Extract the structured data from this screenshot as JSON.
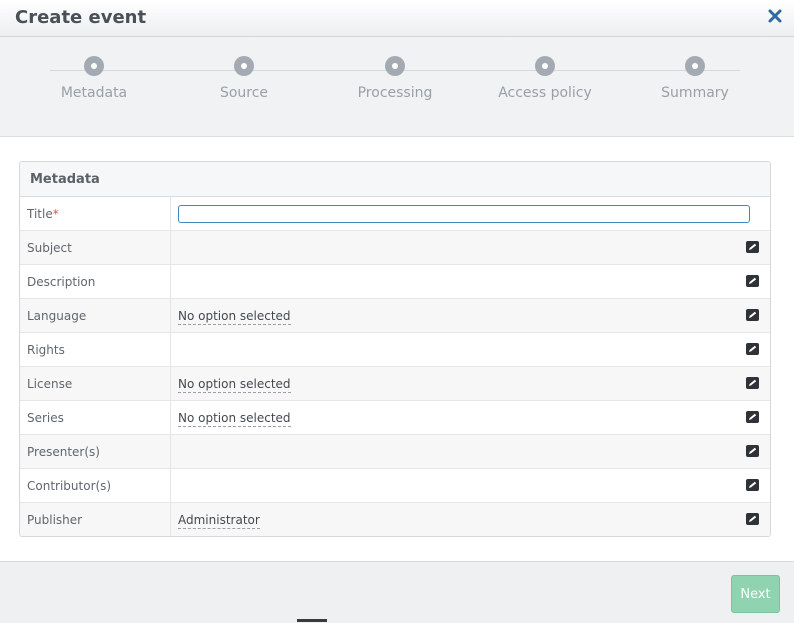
{
  "dialog": {
    "title": "Create event",
    "close_icon": "close-icon"
  },
  "wizard": {
    "steps": [
      {
        "label": "Metadata"
      },
      {
        "label": "Source"
      },
      {
        "label": "Processing"
      },
      {
        "label": "Access policy"
      },
      {
        "label": "Summary"
      }
    ]
  },
  "metadata": {
    "heading": "Metadata",
    "required_marker": "*",
    "rows": [
      {
        "label": "Title",
        "value": ""
      },
      {
        "label": "Subject",
        "value": ""
      },
      {
        "label": "Description",
        "value": ""
      },
      {
        "label": "Language",
        "value": "No option selected"
      },
      {
        "label": "Rights",
        "value": ""
      },
      {
        "label": "License",
        "value": "No option selected"
      },
      {
        "label": "Series",
        "value": "No option selected"
      },
      {
        "label": "Presenter(s)",
        "value": ""
      },
      {
        "label": "Contributor(s)",
        "value": ""
      },
      {
        "label": "Publisher",
        "value": "Administrator"
      }
    ]
  },
  "footer": {
    "next_label": "Next"
  },
  "colors": {
    "accent": "#3c8ac0",
    "next_button": "#8fd3b0",
    "required": "#d9534f"
  }
}
